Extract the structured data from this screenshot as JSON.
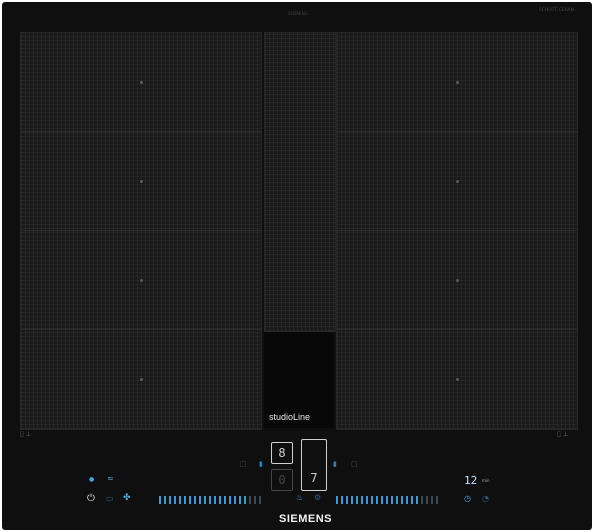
{
  "hob": {
    "brand_top": "SIEMENS",
    "glass_brand": "SCHOTT CERAN",
    "series_label": "studioLine",
    "brand_label": "SIEMENS",
    "left_zones": 4,
    "right_zones": 4
  },
  "controls": {
    "zone_display_left": "8",
    "zone_display_center_top": "0",
    "zone_display_center_right": "7",
    "timer_value": "12",
    "timer_unit": "min"
  },
  "icons": {
    "power": "power-icon",
    "wifi": "wifi-icon",
    "fan": "fan-icon"
  }
}
